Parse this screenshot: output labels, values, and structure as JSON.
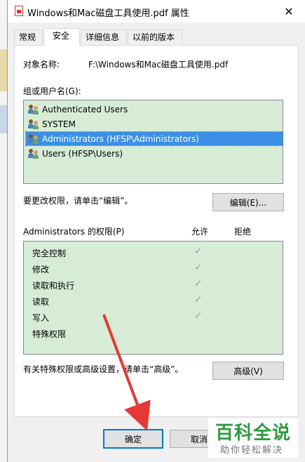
{
  "window": {
    "title": "Windows和Mac磁盘工具使用.pdf 属性",
    "close_glyph": "✕"
  },
  "tabs": [
    {
      "label": "常规",
      "active": false
    },
    {
      "label": "安全",
      "active": true
    },
    {
      "label": "详细信息",
      "active": false
    },
    {
      "label": "以前的版本",
      "active": false
    }
  ],
  "security": {
    "object_name_label": "对象名称:",
    "object_name_value": "F:\\Windows和Mac磁盘工具使用.pdf",
    "group_label": "组或用户名(G):",
    "users": [
      {
        "label": "Authenticated Users",
        "selected": false
      },
      {
        "label": "SYSTEM",
        "selected": false
      },
      {
        "label": "Administrators (HFSP\\Administrators)",
        "selected": true
      },
      {
        "label": "Users (HFSP\\Users)",
        "selected": false
      }
    ],
    "change_hint": "要更改权限，请单击“编辑”。",
    "edit_button": "编辑(E)...",
    "perm_header": "Administrators 的权限(P)",
    "allow_header": "允许",
    "deny_header": "拒绝",
    "permissions": [
      {
        "name": "完全控制",
        "allow": true
      },
      {
        "name": "修改",
        "allow": true
      },
      {
        "name": "读取和执行",
        "allow": true
      },
      {
        "name": "读取",
        "allow": true
      },
      {
        "name": "写入",
        "allow": true
      },
      {
        "name": "特殊权限",
        "allow": false
      }
    ],
    "check_glyph": "✓",
    "advanced_hint": "有关特殊权限或高级设置，请单击“高级”。",
    "advanced_button": "高级(V)"
  },
  "footer": {
    "ok_button": "确定",
    "cancel_button": "取消"
  },
  "watermark": {
    "main": "百科全说",
    "sub": "助你轻松解决"
  },
  "colors": {
    "list_bg": "#d7ecd7",
    "selection": "#3b8fe5",
    "arrow": "#e53935",
    "watermark_green": "#2e9b3e"
  }
}
